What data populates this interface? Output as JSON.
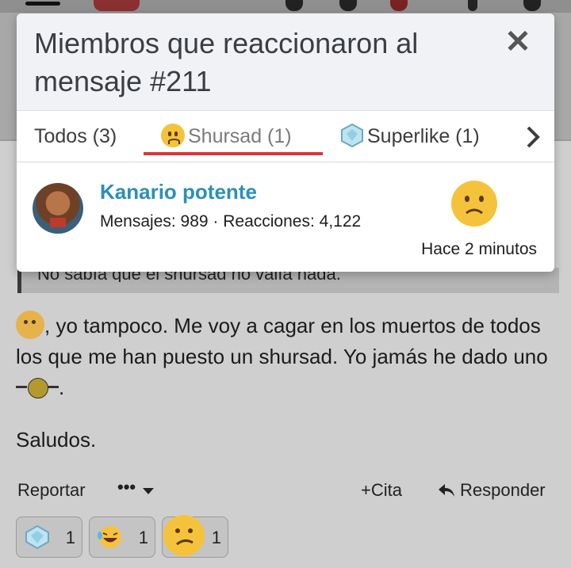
{
  "modal": {
    "title": "Miembros que reaccionaron al mensaje #211",
    "close_label": "✕",
    "tabs": [
      {
        "label": "Todos (3)",
        "icon": ""
      },
      {
        "label": "Shursad (1)",
        "icon": "sad-face-icon"
      },
      {
        "label": "Superlike (1)",
        "icon": "diamond-icon"
      }
    ],
    "active_tab": "Shursad (1)",
    "member": {
      "name": "Kanario potente",
      "stats": "Mensajes: 989 · Reacciones: 4,122",
      "reaction_icon": "sad-face-icon",
      "time": "Hace 2 minutos"
    }
  },
  "post": {
    "quote_text": "No sabía que el shursad no valía nada.",
    "body_line": ", yo tampoco. Me voy a cagar en los muertos de todos los que me han puesto un shursad. Yo jamás he dado uno",
    "body_end": ".",
    "greeting": "Saludos.",
    "actions": {
      "report": "Reportar",
      "more": "•••",
      "quote": "+Cita",
      "reply": "Responder"
    },
    "reactions": [
      {
        "icon": "diamond-icon",
        "count": "1"
      },
      {
        "icon": "laughing-face-icon",
        "count": "1"
      },
      {
        "icon": "sad-face-icon",
        "count": "1"
      }
    ]
  },
  "colors": {
    "accent_underline": "#d8363b",
    "member_name": "#2b8fb8",
    "emoji_yellow": "#f5c33b"
  }
}
